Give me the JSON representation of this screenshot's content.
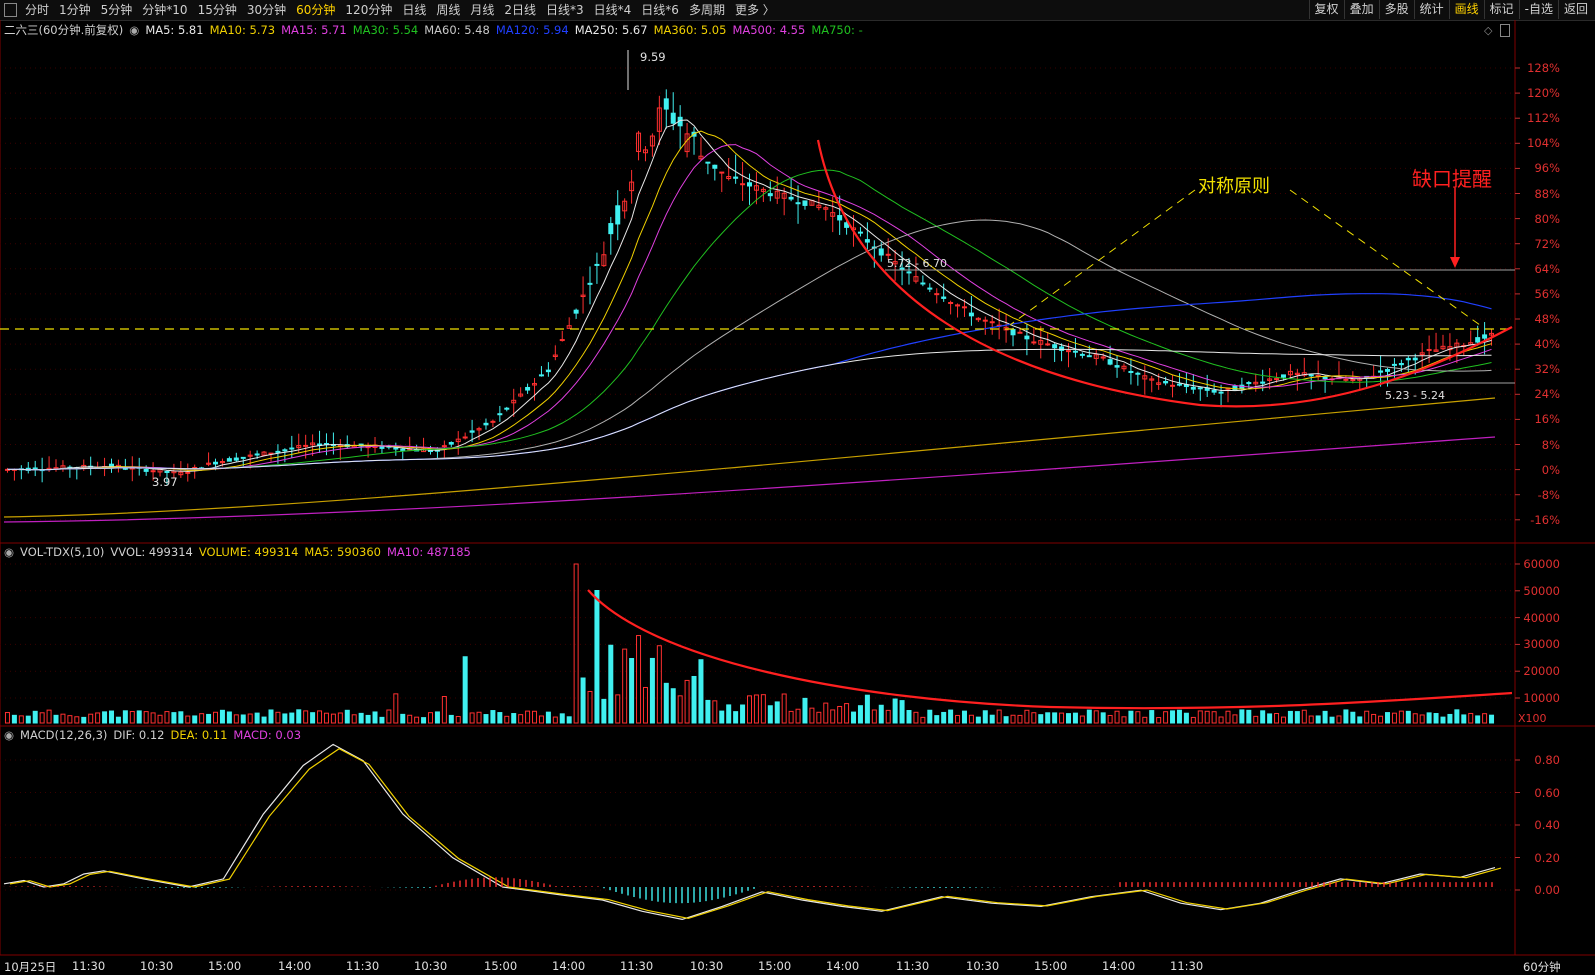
{
  "toolbar": {
    "periods": [
      "分时",
      "1分钟",
      "5分钟",
      "分钟*10",
      "15分钟",
      "30分钟",
      "60分钟",
      "120分钟",
      "日线",
      "周线",
      "月线",
      "2日线",
      "日线*3",
      "日线*4",
      "日线*6",
      "多周期",
      "更多 〉"
    ],
    "active_period": "60分钟",
    "right_buttons": [
      "复权",
      "叠加",
      "多股",
      "统计",
      "画线",
      "标记",
      "-自选",
      "返回"
    ],
    "highlight_button": "画线"
  },
  "main_legend": {
    "title": "二六三(60分钟.前复权)",
    "items": [
      {
        "label": "MA5: 5.81",
        "color": "#e8e8e8"
      },
      {
        "label": "MA10: 5.73",
        "color": "#f0d000"
      },
      {
        "label": "MA15: 5.71",
        "color": "#e040e0"
      },
      {
        "label": "MA30: 5.54",
        "color": "#20c020"
      },
      {
        "label": "MA60: 5.48",
        "color": "#c8c8c8"
      },
      {
        "label": "MA120: 5.94",
        "color": "#2040ff"
      },
      {
        "label": "MA250: 5.67",
        "color": "#e8e8e8"
      },
      {
        "label": "MA360: 5.05",
        "color": "#f0d000"
      },
      {
        "label": "MA500: 4.55",
        "color": "#e040e0"
      },
      {
        "label": "MA750: -",
        "color": "#20c020"
      }
    ]
  },
  "price_axis": [
    "128%",
    "120%",
    "112%",
    "104%",
    "96%",
    "88%",
    "80%",
    "72%",
    "64%",
    "56%",
    "48%",
    "40%",
    "32%",
    "24%",
    "16%",
    "8%",
    "0%",
    "-8%",
    "-16%"
  ],
  "price_labels": {
    "high": "9.59",
    "low": "3.97",
    "range_top": "5.72 - 6.70",
    "range_bottom": "5.23 - 5.24"
  },
  "annotations": {
    "symmetry": "对称原则",
    "gap_alert": "缺口提醒"
  },
  "vol_legend": {
    "items": [
      {
        "label": "VOL-TDX(5,10)",
        "color": "#d0d0d0"
      },
      {
        "label": "VVOL: 499314",
        "color": "#d0d0d0"
      },
      {
        "label": "VOLUME: 499314",
        "color": "#f0d000"
      },
      {
        "label": "MA5: 590360",
        "color": "#f0d000"
      },
      {
        "label": "MA10: 487185",
        "color": "#e040e0"
      }
    ]
  },
  "vol_axis": [
    "60000",
    "50000",
    "40000",
    "30000",
    "20000",
    "10000"
  ],
  "vol_unit": "X100",
  "macd_legend": {
    "items": [
      {
        "label": "MACD(12,26,3)",
        "color": "#d0d0d0"
      },
      {
        "label": "DIF: 0.12",
        "color": "#d0d0d0"
      },
      {
        "label": "DEA: 0.11",
        "color": "#f0d000"
      },
      {
        "label": "MACD: 0.03",
        "color": "#e040e0"
      }
    ]
  },
  "macd_axis": [
    "0.80",
    "0.60",
    "0.40",
    "0.20",
    "0.00"
  ],
  "time_axis": [
    "10月25日",
    "11:30",
    "10:30",
    "15:00",
    "14:00",
    "11:30",
    "10:30",
    "15:00",
    "14:00",
    "11:30",
    "10:30",
    "15:00",
    "14:00",
    "11:30",
    "10:30",
    "15:00",
    "14:00",
    "11:30"
  ],
  "period_label": "60分钟",
  "colors": {
    "up": "#ff3030",
    "down": "#40f0f0",
    "dash": "#f0e000",
    "curve": "#ff2020"
  }
}
